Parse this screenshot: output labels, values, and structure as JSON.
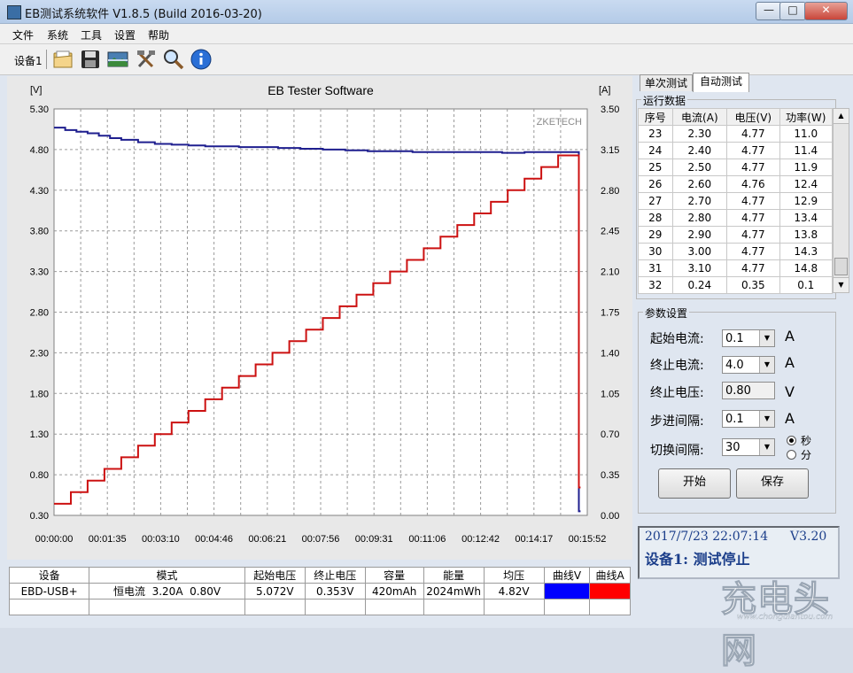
{
  "window": {
    "title": "EB测试系统软件 V1.8.5 (Build 2016-03-20)",
    "minimize": "—",
    "maximize": "□",
    "close": "✕"
  },
  "menu": [
    "文件",
    "系统",
    "工具",
    "设置",
    "帮助"
  ],
  "toolbar": {
    "device_label": "设备1",
    "icons": [
      "open-folder-icon",
      "save-disk-icon",
      "image-icon",
      "tools-icon",
      "search-icon",
      "info-icon"
    ]
  },
  "chart_data": {
    "type": "line",
    "title": "EB Tester Software",
    "watermark": "ZKETECH",
    "y_left_unit": "[V]",
    "y_right_unit": "[A]",
    "y_left_ticks": [
      "5.30",
      "4.80",
      "4.30",
      "3.80",
      "3.30",
      "2.80",
      "2.30",
      "1.80",
      "1.30",
      "0.80",
      "0.30"
    ],
    "y_right_ticks": [
      "3.50",
      "3.15",
      "2.80",
      "2.45",
      "2.10",
      "1.75",
      "1.40",
      "1.05",
      "0.70",
      "0.35",
      "0.00"
    ],
    "x_ticks": [
      "00:00:00",
      "00:01:35",
      "00:03:10",
      "00:04:46",
      "00:06:21",
      "00:07:56",
      "00:09:31",
      "00:11:06",
      "00:12:42",
      "00:14:17",
      "00:15:52"
    ],
    "ylim_left": [
      0.3,
      5.3
    ],
    "ylim_right": [
      0,
      3.5
    ],
    "xlim_seconds": [
      0,
      952
    ],
    "grid": true,
    "series": [
      {
        "axis": "left",
        "color": "#1f1f8f",
        "x": [
          0,
          20,
          40,
          60,
          80,
          100,
          120,
          150,
          180,
          210,
          240,
          270,
          300,
          330,
          360,
          400,
          440,
          480,
          520,
          560,
          600,
          640,
          680,
          720,
          760,
          800,
          840,
          870,
          900,
          920,
          935,
          937,
          940
        ],
        "y": [
          5.07,
          5.04,
          5.02,
          5.0,
          4.97,
          4.94,
          4.92,
          4.89,
          4.87,
          4.86,
          4.85,
          4.84,
          4.84,
          4.83,
          4.83,
          4.82,
          4.81,
          4.8,
          4.79,
          4.78,
          4.78,
          4.77,
          4.77,
          4.77,
          4.77,
          4.76,
          4.77,
          4.77,
          4.77,
          4.77,
          4.77,
          0.35,
          0.35
        ]
      },
      {
        "axis": "right",
        "color": "#cc1111",
        "x": [
          0,
          30,
          60,
          90,
          120,
          150,
          180,
          210,
          240,
          270,
          300,
          330,
          360,
          390,
          420,
          450,
          480,
          510,
          540,
          570,
          600,
          630,
          660,
          690,
          720,
          750,
          780,
          810,
          840,
          870,
          900,
          935,
          937,
          940
        ],
        "y": [
          0.1,
          0.2,
          0.3,
          0.4,
          0.5,
          0.6,
          0.7,
          0.8,
          0.9,
          1.0,
          1.1,
          1.2,
          1.3,
          1.4,
          1.5,
          1.6,
          1.7,
          1.8,
          1.9,
          2.0,
          2.1,
          2.2,
          2.3,
          2.4,
          2.5,
          2.6,
          2.7,
          2.8,
          2.9,
          3.0,
          3.1,
          3.1,
          0.24,
          0.24
        ]
      }
    ]
  },
  "status": {
    "headers": [
      "设备",
      "模式",
      "起始电压",
      "终止电压",
      "容量",
      "能量",
      "均压",
      "曲线V",
      "曲线A"
    ],
    "row": [
      "EBD-USB+",
      "恒电流  3.20A  0.80V",
      "5.072V",
      "0.353V",
      "420mAh",
      "2024mWh",
      "4.82V"
    ],
    "curve_v_color": "#0000ff",
    "curve_a_color": "#ff0000"
  },
  "tabs": [
    "单次测试",
    "自动测试"
  ],
  "run_data": {
    "title": "运行数据",
    "headers": [
      "序号",
      "电流(A)",
      "电压(V)",
      "功率(W)"
    ],
    "rows": [
      [
        "23",
        "2.30",
        "4.77",
        "11.0"
      ],
      [
        "24",
        "2.40",
        "4.77",
        "11.4"
      ],
      [
        "25",
        "2.50",
        "4.77",
        "11.9"
      ],
      [
        "26",
        "2.60",
        "4.76",
        "12.4"
      ],
      [
        "27",
        "2.70",
        "4.77",
        "12.9"
      ],
      [
        "28",
        "2.80",
        "4.77",
        "13.4"
      ],
      [
        "29",
        "2.90",
        "4.77",
        "13.8"
      ],
      [
        "30",
        "3.00",
        "4.77",
        "14.3"
      ],
      [
        "31",
        "3.10",
        "4.77",
        "14.8"
      ],
      [
        "32",
        "0.24",
        "0.35",
        "0.1"
      ]
    ]
  },
  "params": {
    "title": "参数设置",
    "start_current": {
      "label": "起始电流:",
      "value": "0.1",
      "unit": "A"
    },
    "end_current": {
      "label": "终止电流:",
      "value": "4.0",
      "unit": "A"
    },
    "end_voltage": {
      "label": "终止电压:",
      "value": "0.80",
      "unit": "V"
    },
    "step": {
      "label": "步进间隔:",
      "value": "0.1",
      "unit": "A"
    },
    "interval": {
      "label": "切换间隔:",
      "value": "30",
      "unit_sec": "秒",
      "unit_min": "分"
    },
    "start_button": "开始",
    "save_button": "保存"
  },
  "lcd": {
    "datetime": "2017/7/23  22:07:14",
    "version": "V3.20",
    "status": "设备1: 测试停止"
  },
  "watermark": {
    "text": "充电头网",
    "url": "www.chongdiantou.com"
  }
}
